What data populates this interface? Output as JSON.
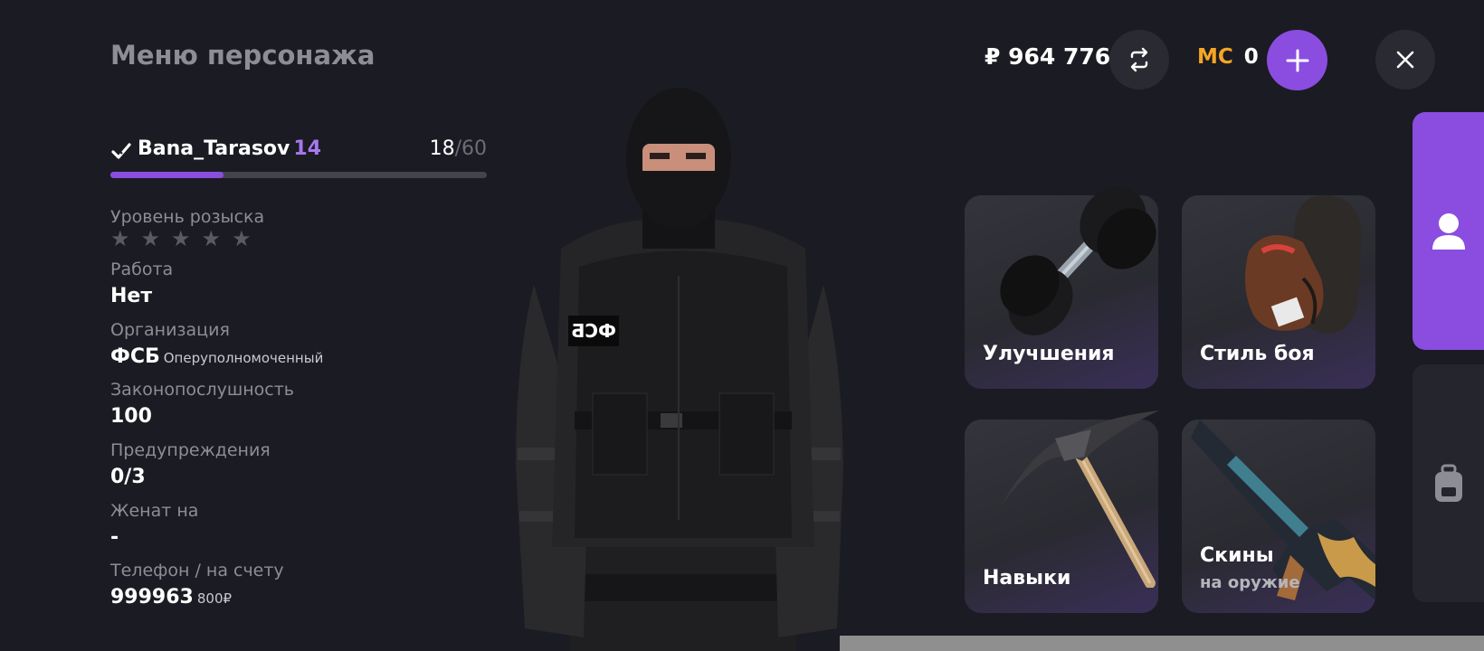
{
  "header": {
    "title": "Меню персонажа",
    "balance": "₽ 964 776",
    "mc_label": "MC",
    "mc_value": "0"
  },
  "player": {
    "name": "Bana_Tarasov",
    "level": "14",
    "xp_current": "18",
    "xp_separator": "/",
    "xp_max": "60",
    "xp_fraction": 0.3
  },
  "stats": {
    "wanted_label": "Уровень розыска",
    "wanted_stars_total": 5,
    "wanted_stars_active": 0,
    "job_label": "Работа",
    "job_value": "Нет",
    "org_label": "Организация",
    "org_value": "ФСБ",
    "org_rank": "Оперуполномоченный",
    "law_label": "Законопослушность",
    "law_value": "100",
    "warnings_label": "Предупреждения",
    "warnings_value": "0/3",
    "married_label": "Женат на",
    "married_value": "-",
    "phone_label": "Телефон / на счету",
    "phone_value": "999963",
    "phone_balance": "800₽"
  },
  "character": {
    "patch_text": "ФСБ"
  },
  "cards": [
    {
      "label": "Улучшения",
      "icon": "dumbbell-icon"
    },
    {
      "label": "Стиль боя",
      "icon": "boxing-gloves-icon"
    },
    {
      "label": "Навыки",
      "icon": "pickaxe-icon"
    },
    {
      "label": "Скины",
      "sub": "на оружие",
      "icon": "rifle-icon"
    }
  ],
  "side_tabs": [
    {
      "icon": "user-icon",
      "active": true
    },
    {
      "icon": "backpack-icon",
      "active": false
    }
  ],
  "colors": {
    "background": "#1b1b23",
    "accent": "#8a4de0",
    "mc": "#f5a623",
    "muted": "#8d8d95"
  }
}
